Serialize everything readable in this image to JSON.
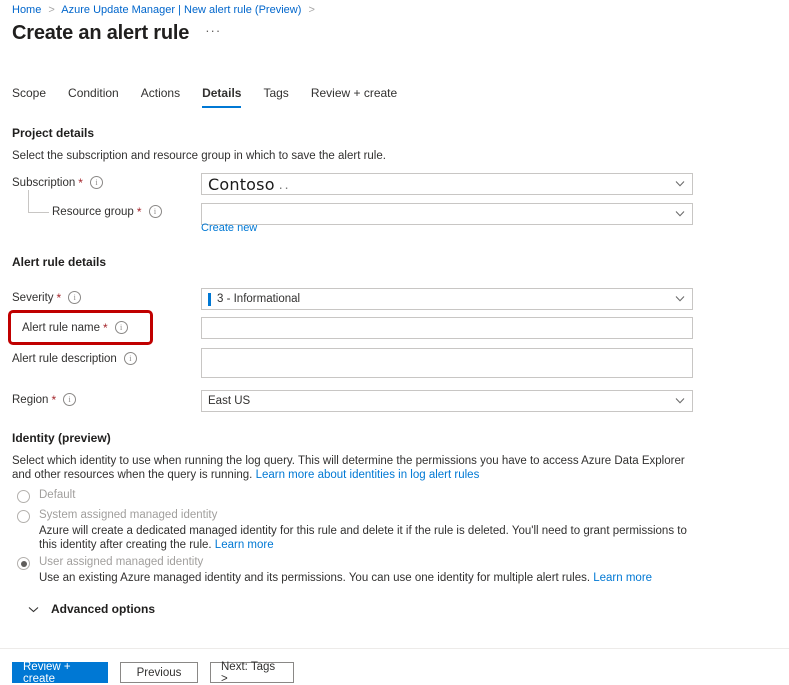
{
  "breadcrumb": {
    "items": [
      "Home",
      "Azure Update Manager | New alert rule (Preview)"
    ],
    "separator": ">"
  },
  "header": {
    "title": "Create an alert rule",
    "more_label": "···"
  },
  "tabs": [
    {
      "label": "Scope",
      "active": false
    },
    {
      "label": "Condition",
      "active": false
    },
    {
      "label": "Actions",
      "active": false
    },
    {
      "label": "Details",
      "active": true
    },
    {
      "label": "Tags",
      "active": false
    },
    {
      "label": "Review + create",
      "active": false
    }
  ],
  "project_details": {
    "title": "Project details",
    "description": "Select the subscription and resource group in which to save the alert rule.",
    "subscription": {
      "label": "Subscription",
      "required_marker": "*",
      "value": "Contoso",
      "value_suffix": "..",
      "info": "i"
    },
    "resource_group": {
      "label": "Resource group",
      "required_marker": "*",
      "value": "",
      "placeholder": "",
      "create_new_link": "Create new",
      "info": "i"
    }
  },
  "alert_rule_details": {
    "title": "Alert rule details",
    "severity": {
      "label": "Severity",
      "required_marker": "*",
      "value": "3 - Informational",
      "severity_color": "#0078d4",
      "info": "i"
    },
    "alert_rule_name": {
      "label": "Alert rule name",
      "required_marker": "*",
      "value": "",
      "placeholder": "",
      "info": "i",
      "highlighted": true,
      "highlight_color": "#c00000"
    },
    "alert_rule_description": {
      "label": "Alert rule description",
      "value": "",
      "placeholder": "",
      "info": "i"
    },
    "region": {
      "label": "Region",
      "required_marker": "*",
      "value": "East US",
      "info": "i"
    }
  },
  "identity": {
    "title": "Identity (preview)",
    "description_line1": "Select which identity to use when running the log query. This will determine the permissions you have to access Azure Data Explorer and other resources when",
    "description_line2_prefix": "the query is running. ",
    "description_link": "Learn more about identities in log alert rules",
    "options": [
      {
        "label": "Default",
        "selected": false,
        "disabled": true,
        "description": "",
        "description_link": ""
      },
      {
        "label": "System assigned managed identity",
        "selected": false,
        "disabled": true,
        "description": "Azure will create a dedicated managed identity for this rule and delete it if the rule is deleted. You'll need to grant permissions to this identity after creating the rule. ",
        "description_link": "Learn more"
      },
      {
        "label": "User assigned managed identity",
        "selected": true,
        "disabled": false,
        "description": "Use an existing Azure managed identity and its permissions. You can use one identity for multiple alert rules. ",
        "description_link": "Learn more"
      }
    ]
  },
  "advanced_options": {
    "label": "Advanced options",
    "expanded": false
  },
  "footer": {
    "buttons": [
      {
        "label": "Review + create",
        "style": "primary"
      },
      {
        "label": "Previous",
        "style": "default"
      },
      {
        "label": "Next: Tags >",
        "style": "default"
      }
    ]
  },
  "colors": {
    "accent": "#0078d4",
    "link": "#0078d4",
    "required": "#a4262c",
    "annotation": "#c00000",
    "border": "#c8c6c4"
  }
}
